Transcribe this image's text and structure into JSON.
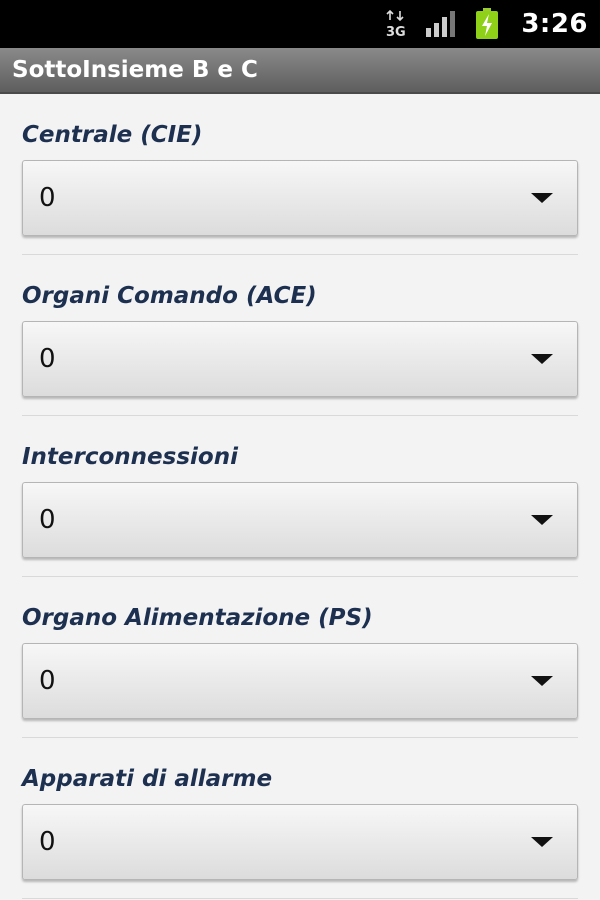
{
  "status_bar": {
    "time": "3:26",
    "network_icon": "3g-data-icon",
    "signal_icon": "signal-strength-icon",
    "battery_icon": "battery-charging-icon"
  },
  "title_bar": {
    "title": "SottoInsieme B e C"
  },
  "form": {
    "groups": [
      {
        "label": "Centrale (CIE)",
        "value": "0"
      },
      {
        "label": "Organi Comando (ACE)",
        "value": "0"
      },
      {
        "label": "Interconnessioni",
        "value": "0"
      },
      {
        "label": "Organo Alimentazione (PS)",
        "value": "0"
      },
      {
        "label": "Apparati di allarme",
        "value": "0"
      }
    ]
  },
  "colors": {
    "status_bar_bg": "#000000",
    "title_bar_bg": "#6f6f6f",
    "label_text": "#1d3050",
    "background": "#f3f3f3"
  }
}
